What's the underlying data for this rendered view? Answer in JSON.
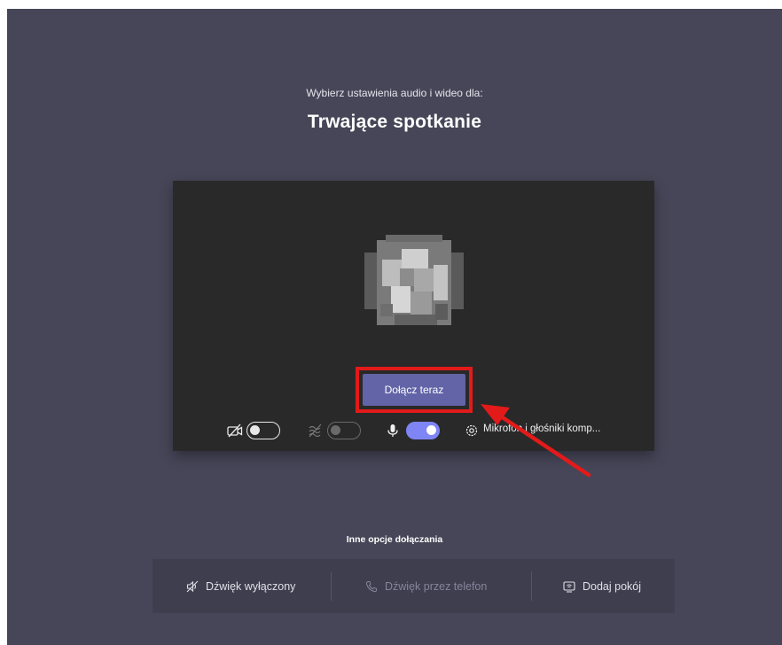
{
  "prejoin": {
    "subtitle": "Wybierz ustawienia audio i wideo dla:",
    "meeting_title": "Trwające spotkanie"
  },
  "preview": {
    "join_button_label": "Dołącz teraz",
    "camera_toggle": "off",
    "background_blur_toggle": "off-disabled",
    "microphone_toggle": "on",
    "device_label": "Mikrofon i głośniki komp..."
  },
  "other_options": {
    "heading": "Inne opcje dołączania",
    "items": [
      {
        "label": "Dźwięk wyłączony",
        "icon": "speaker-off-icon"
      },
      {
        "label": "Dźwięk przez telefon",
        "icon": "phone-icon"
      },
      {
        "label": "Dodaj pokój",
        "icon": "room-display-icon"
      }
    ]
  },
  "colors": {
    "background": "#464658",
    "preview": "#292929",
    "primary": "#6264a7",
    "toggle_on": "#7f85f5",
    "highlight": "#e31a1a"
  }
}
